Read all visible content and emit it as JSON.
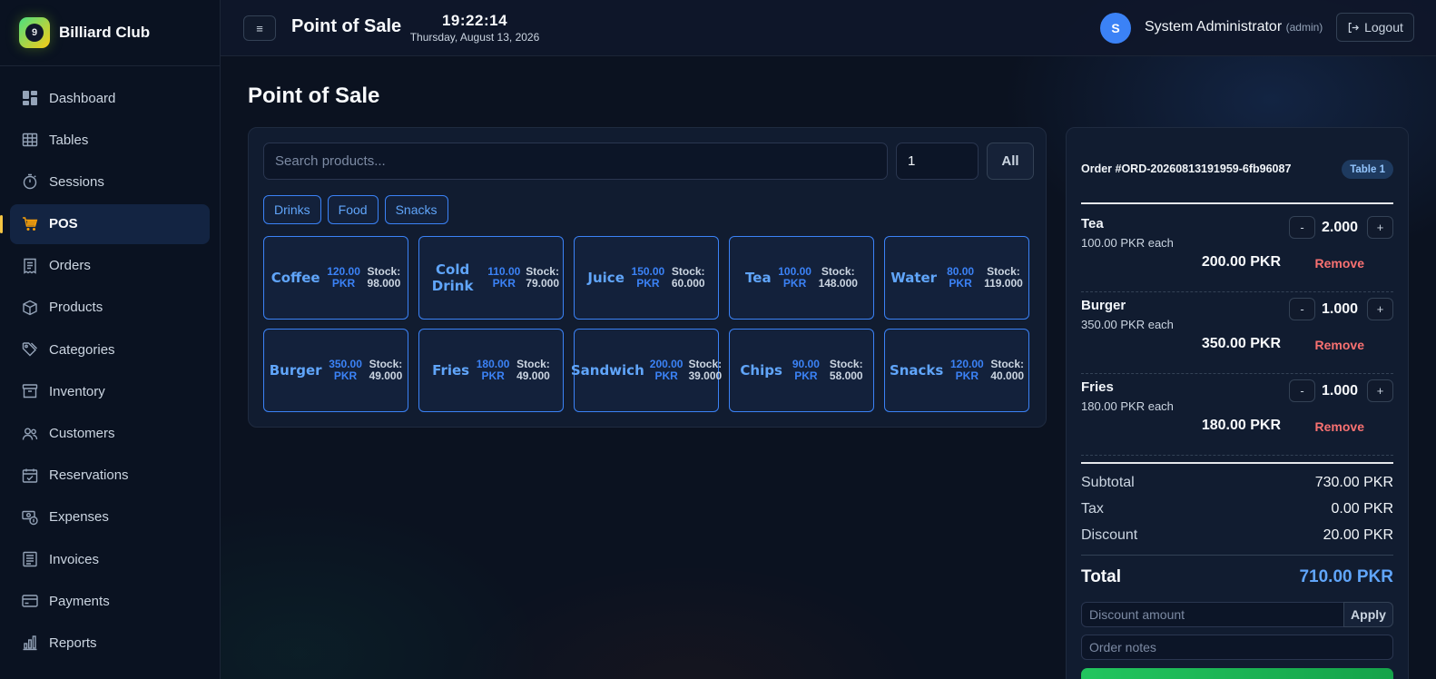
{
  "brand": {
    "name": "Billiard Club",
    "logo_glyph": "9"
  },
  "sidebar": {
    "items": [
      {
        "label": "Dashboard",
        "icon": "dashboard-icon",
        "active": false
      },
      {
        "label": "Tables",
        "icon": "table-grid-icon",
        "active": false
      },
      {
        "label": "Sessions",
        "icon": "stopwatch-icon",
        "active": false
      },
      {
        "label": "POS",
        "icon": "cart-icon",
        "active": true
      },
      {
        "label": "Orders",
        "icon": "receipt-icon",
        "active": false
      },
      {
        "label": "Products",
        "icon": "box-icon",
        "active": false
      },
      {
        "label": "Categories",
        "icon": "tags-icon",
        "active": false
      },
      {
        "label": "Inventory",
        "icon": "archive-icon",
        "active": false
      },
      {
        "label": "Customers",
        "icon": "people-icon",
        "active": false
      },
      {
        "label": "Reservations",
        "icon": "calendar-check-icon",
        "active": false
      },
      {
        "label": "Expenses",
        "icon": "cash-coin-icon",
        "active": false
      },
      {
        "label": "Invoices",
        "icon": "invoice-icon",
        "active": false
      },
      {
        "label": "Payments",
        "icon": "credit-card-icon",
        "active": false
      },
      {
        "label": "Reports",
        "icon": "bar-chart-icon",
        "active": false
      }
    ]
  },
  "header": {
    "menu_glyph": "≡",
    "title": "Point of Sale",
    "time": "19:22:14",
    "date": "Thursday, August 13, 2026",
    "user_initial": "S",
    "user_name": "System Administrator",
    "user_role": "(admin)",
    "logout_label": "Logout"
  },
  "main": {
    "page_title": "Point of Sale",
    "search_placeholder": "Search products...",
    "quantity_value": "1",
    "all_label": "All",
    "categories": [
      "Drinks",
      "Food",
      "Snacks"
    ],
    "products": [
      {
        "name": "Coffee",
        "price": "120.00",
        "currency": "PKR",
        "stock_label": "Stock:",
        "stock": "98.000"
      },
      {
        "name": "Cold Drink",
        "price": "110.00",
        "currency": "PKR",
        "stock_label": "Stock:",
        "stock": "79.000"
      },
      {
        "name": "Juice",
        "price": "150.00",
        "currency": "PKR",
        "stock_label": "Stock:",
        "stock": "60.000"
      },
      {
        "name": "Tea",
        "price": "100.00",
        "currency": "PKR",
        "stock_label": "Stock:",
        "stock": "148.000"
      },
      {
        "name": "Water",
        "price": "80.00",
        "currency": "PKR",
        "stock_label": "Stock:",
        "stock": "119.000"
      },
      {
        "name": "Burger",
        "price": "350.00",
        "currency": "PKR",
        "stock_label": "Stock:",
        "stock": "49.000"
      },
      {
        "name": "Fries",
        "price": "180.00",
        "currency": "PKR",
        "stock_label": "Stock:",
        "stock": "49.000"
      },
      {
        "name": "Sandwich",
        "price": "200.00",
        "currency": "PKR",
        "stock_label": "Stock:",
        "stock": "39.000"
      },
      {
        "name": "Chips",
        "price": "90.00",
        "currency": "PKR",
        "stock_label": "Stock:",
        "stock": "58.000"
      },
      {
        "name": "Snacks",
        "price": "120.00",
        "currency": "PKR",
        "stock_label": "Stock:",
        "stock": "40.000"
      }
    ]
  },
  "order": {
    "id_label": "Order #ORD-20260813191959-6fb96087",
    "table_badge": "Table 1",
    "items": [
      {
        "name": "Tea",
        "each": "100.00 PKR each",
        "qty": "2.000",
        "total": "200.00 PKR",
        "remove_label": "Remove"
      },
      {
        "name": "Burger",
        "each": "350.00 PKR each",
        "qty": "1.000",
        "total": "350.00 PKR",
        "remove_label": "Remove"
      },
      {
        "name": "Fries",
        "each": "180.00 PKR each",
        "qty": "1.000",
        "total": "180.00 PKR",
        "remove_label": "Remove"
      }
    ],
    "minus_glyph": "-",
    "plus_glyph": "+",
    "subtotal_label": "Subtotal",
    "subtotal": "730.00 PKR",
    "tax_label": "Tax",
    "tax": "0.00 PKR",
    "discount_label": "Discount",
    "discount": "20.00 PKR",
    "total_label": "Total",
    "total": "710.00 PKR",
    "discount_placeholder": "Discount amount",
    "apply_label": "Apply",
    "notes_placeholder": "Order notes"
  },
  "colors": {
    "accent": "#3b82f6",
    "active_marker": "#f5c542",
    "danger": "#f87171",
    "success": "#22c55e"
  }
}
